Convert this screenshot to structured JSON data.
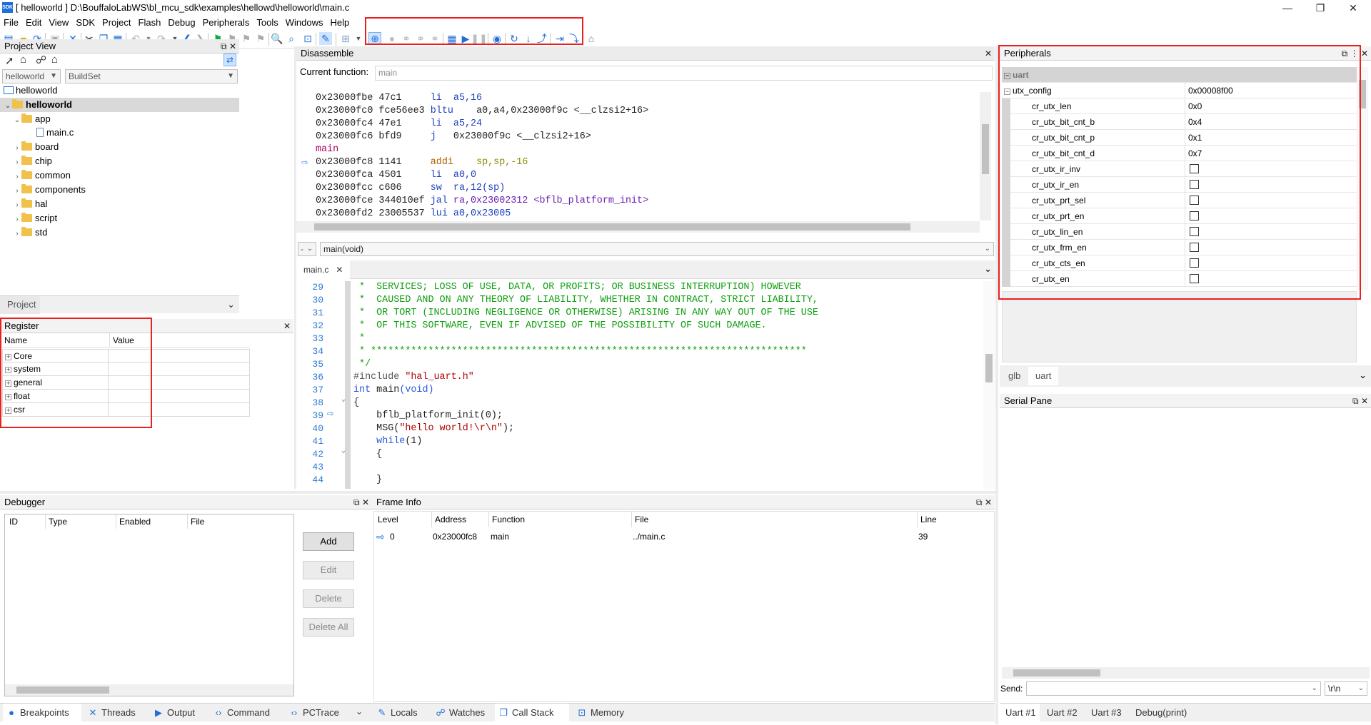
{
  "window": {
    "title": "[ helloworld ] D:\\BouffaloLabWS\\bl_mcu_sdk\\examples\\hellowd\\helloworld\\main.c",
    "app_icon_text": "SDK",
    "minimize": "—",
    "maximize": "❐",
    "close": "✕"
  },
  "menu": [
    "File",
    "Edit",
    "View",
    "SDK",
    "Project",
    "Flash",
    "Debug",
    "Peripherals",
    "Tools",
    "Windows",
    "Help"
  ],
  "project_view": {
    "title": "Project View",
    "project_combo": "helloworld",
    "build_combo": "BuildSet",
    "workspace": "helloworld",
    "project": "helloworld",
    "tree": [
      {
        "label": "app",
        "level": 1,
        "type": "folder",
        "expanded": true
      },
      {
        "label": "main.c",
        "level": 2,
        "type": "file"
      },
      {
        "label": "board",
        "level": 1,
        "type": "folder"
      },
      {
        "label": "chip",
        "level": 1,
        "type": "folder"
      },
      {
        "label": "common",
        "level": 1,
        "type": "folder"
      },
      {
        "label": "components",
        "level": 1,
        "type": "folder"
      },
      {
        "label": "hal",
        "level": 1,
        "type": "folder"
      },
      {
        "label": "script",
        "level": 1,
        "type": "folder"
      },
      {
        "label": "std",
        "level": 1,
        "type": "folder"
      }
    ],
    "tab": "Project"
  },
  "register": {
    "title": "Register",
    "col_name": "Name",
    "col_value": "Value",
    "rows": [
      "Core",
      "system",
      "general",
      "float",
      "csr"
    ]
  },
  "disassemble": {
    "title": "Disassemble",
    "current_function_label": "Current function:",
    "current_function": "main",
    "lines": [
      {
        "addr": "0x23000fbe",
        "op": "47c1",
        "mn": "li",
        "args": "a5,16",
        "kind": "li"
      },
      {
        "addr": "0x23000fc0",
        "op": "fce56ee3",
        "mn": "bltu",
        "args": "a0,a4,0x23000f9c <__clzsi2+16>",
        "kind": "br"
      },
      {
        "addr": "0x23000fc4",
        "op": "47e1",
        "mn": "li",
        "args": "a5,24",
        "kind": "li"
      },
      {
        "addr": "0x23000fc6",
        "op": "bfd9",
        "mn": "j",
        "args": "0x23000f9c <__clzsi2+16>",
        "kind": "br"
      },
      {
        "addr": "main",
        "op": "",
        "mn": "",
        "args": "",
        "kind": "label"
      },
      {
        "addr": "0x23000fc8",
        "op": "1141",
        "mn": "addi",
        "args": "sp,sp,-16",
        "kind": "cur"
      },
      {
        "addr": "0x23000fca",
        "op": "4501",
        "mn": "li",
        "args": "a0,0",
        "kind": "li"
      },
      {
        "addr": "0x23000fcc",
        "op": "c606",
        "mn": "sw",
        "args": "ra,12(sp)",
        "kind": "li"
      },
      {
        "addr": "0x23000fce",
        "op": "344010ef",
        "mn": "jal",
        "args": "ra,0x23002312 <bflb_platform_init>",
        "kind": "br"
      },
      {
        "addr": "0x23000fd2",
        "op": "23005537",
        "mn": "lui",
        "args": "a0,0x23005",
        "kind": "li"
      }
    ]
  },
  "editor": {
    "scope_combo": "-",
    "function_combo": "main(void)",
    "tab": "main.c",
    "lines": [
      {
        "n": "29",
        "t": " *  SERVICES; LOSS OF USE, DATA, OR PROFITS; OR BUSINESS INTERRUPTION) HOWEVER",
        "k": "c"
      },
      {
        "n": "30",
        "t": " *  CAUSED AND ON ANY THEORY OF LIABILITY, WHETHER IN CONTRACT, STRICT LIABILITY,",
        "k": "c"
      },
      {
        "n": "31",
        "t": " *  OR TORT (INCLUDING NEGLIGENCE OR OTHERWISE) ARISING IN ANY WAY OUT OF THE USE",
        "k": "c"
      },
      {
        "n": "32",
        "t": " *  OF THIS SOFTWARE, EVEN IF ADVISED OF THE POSSIBILITY OF SUCH DAMAGE.",
        "k": "c"
      },
      {
        "n": "33",
        "t": " *",
        "k": "c"
      },
      {
        "n": "34",
        "t": " * ****************************************************************************",
        "k": "c"
      },
      {
        "n": "35",
        "t": " */",
        "k": "c"
      },
      {
        "n": "36",
        "t": "",
        "k": "inc"
      },
      {
        "n": "37",
        "t": "",
        "k": "main"
      },
      {
        "n": "38",
        "t": "{",
        "k": "p"
      },
      {
        "n": "39",
        "t": "",
        "k": "init"
      },
      {
        "n": "40",
        "t": "",
        "k": "msg"
      },
      {
        "n": "41",
        "t": "",
        "k": "while"
      },
      {
        "n": "42",
        "t": "    {",
        "k": "p"
      },
      {
        "n": "43",
        "t": "",
        "k": "p"
      },
      {
        "n": "44",
        "t": "    }",
        "k": "p"
      }
    ],
    "code": {
      "include_kw": "#include",
      "include_str": "\"hal_uart.h\"",
      "int_kw": "int",
      "main_name": "main",
      "main_args": "(void)",
      "init_call": "bflb_platform_init(0);",
      "msg_call": "MSG(",
      "msg_str": "\"hello world!\\r\\n\"",
      "msg_end": ");",
      "while_kw": "while",
      "while_args": "(1)"
    }
  },
  "peripherals": {
    "title": "Peripherals",
    "group": "uart",
    "register": {
      "name": "utx_config",
      "value": "0x00008f00"
    },
    "fields": [
      {
        "name": "cr_utx_len",
        "value": "0x0"
      },
      {
        "name": "cr_utx_bit_cnt_b",
        "value": "0x4"
      },
      {
        "name": "cr_utx_bit_cnt_p",
        "value": "0x1"
      },
      {
        "name": "cr_utx_bit_cnt_d",
        "value": "0x7"
      },
      {
        "name": "cr_utx_ir_inv",
        "value": ""
      },
      {
        "name": "cr_utx_ir_en",
        "value": ""
      },
      {
        "name": "cr_utx_prt_sel",
        "value": ""
      },
      {
        "name": "cr_utx_prt_en",
        "value": ""
      },
      {
        "name": "cr_utx_lin_en",
        "value": ""
      },
      {
        "name": "cr_utx_frm_en",
        "value": ""
      },
      {
        "name": "cr_utx_cts_en",
        "value": ""
      },
      {
        "name": "cr_utx_en",
        "value": ""
      }
    ],
    "tabs": [
      "glb",
      "uart"
    ]
  },
  "serial": {
    "title": "Serial Pane",
    "send_label": "Send:",
    "line_ending": "\\r\\n",
    "tabs": [
      "Uart #1",
      "Uart #2",
      "Uart #3",
      "Debug(print)"
    ]
  },
  "debugger": {
    "title": "Debugger",
    "columns": [
      "ID",
      "Type",
      "Enabled",
      "File"
    ],
    "buttons": {
      "add": "Add",
      "edit": "Edit",
      "delete": "Delete",
      "delete_all": "Delete All"
    },
    "tabs": [
      "Breakpoints",
      "Threads",
      "Output",
      "Command",
      "PCTrace"
    ]
  },
  "frame_info": {
    "title": "Frame Info",
    "columns": [
      "Level",
      "Address",
      "Function",
      "File",
      "Line"
    ],
    "rows": [
      {
        "level": "0",
        "address": "0x23000fc8",
        "function": "main",
        "file": "../main.c",
        "line": "39"
      }
    ],
    "tabs": [
      "Locals",
      "Watches",
      "Call Stack",
      "Memory"
    ]
  },
  "colors": {
    "highlight": "#e8201e",
    "accent": "#1e6fd9",
    "comment": "#10a010",
    "keyword": "#2a5bd7"
  }
}
